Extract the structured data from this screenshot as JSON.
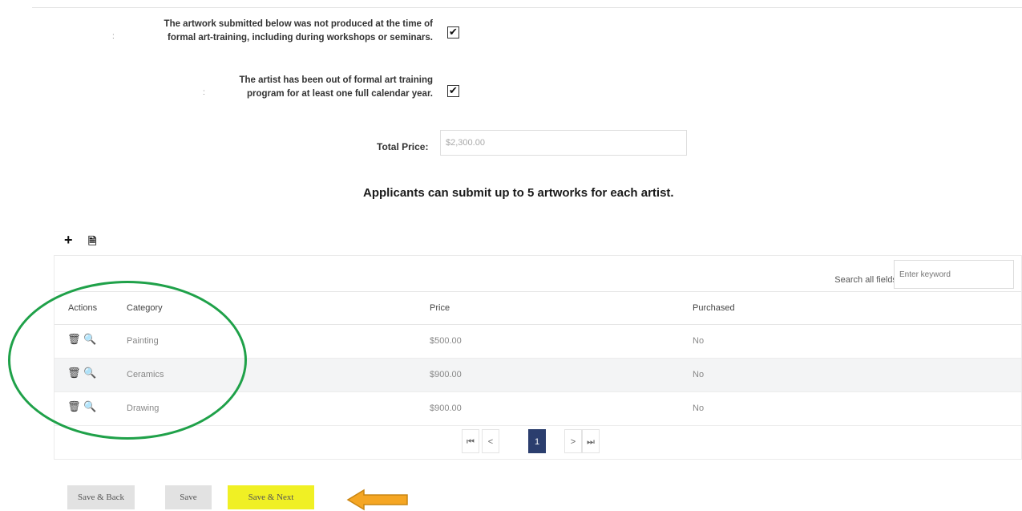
{
  "attestations": [
    {
      "line1": "The artwork submitted below was not produced at the time of",
      "line2": "formal art-training, including during workshops or seminars.",
      "checked": true,
      "check_glyph": "✔"
    },
    {
      "line1": "The artist has been out of formal art training",
      "line2": "program for at least one full calendar year.",
      "checked": true,
      "check_glyph": "✔"
    }
  ],
  "required_mark": ":",
  "total_price": {
    "label": "Total Price:",
    "value": "$2,300.00"
  },
  "info_heading": "Applicants can submit up to 5 artworks for each artist.",
  "toolbar": {
    "add_icon": "+",
    "export_icon": "🗎"
  },
  "grid": {
    "search_label": "Search all fields:",
    "search_placeholder": "Enter keyword",
    "columns": [
      "Actions",
      "Category",
      "Price",
      "Purchased"
    ],
    "rows": [
      {
        "category": "Painting",
        "price": "$500.00",
        "purchased": "No"
      },
      {
        "category": "Ceramics",
        "price": "$900.00",
        "purchased": "No"
      },
      {
        "category": "Drawing",
        "price": "$900.00",
        "purchased": "No"
      }
    ],
    "action_icons": {
      "delete": "🗑",
      "view": "🔍"
    },
    "pagination": {
      "first": "⏮",
      "prev": "<",
      "current": "1",
      "next": ">",
      "last": "⏭"
    }
  },
  "buttons": {
    "save_back": "Save & Back",
    "save": "Save",
    "save_next": "Save & Next"
  },
  "colors": {
    "annotation_circle": "#1fa149",
    "annotation_arrow": "#f5a623",
    "highlight": "#f0f024",
    "pager_active": "#2b3e6e"
  }
}
